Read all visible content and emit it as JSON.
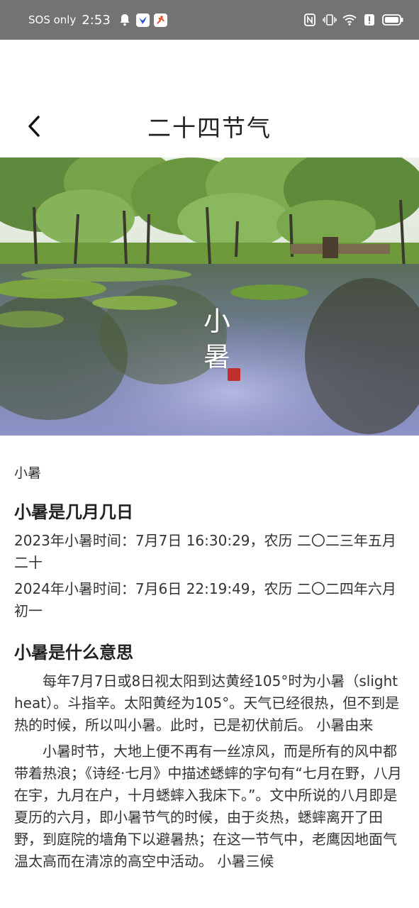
{
  "status_bar": {
    "carrier": "SOS only",
    "time": "2:53"
  },
  "header": {
    "title": "二十四节气"
  },
  "hero": {
    "title_line1": "小",
    "title_line2": "暑"
  },
  "breadcrumb": "小暑",
  "sections": [
    {
      "heading": "小暑是几月几日",
      "paragraphs": [
        "2023年小暑时间：7月7日 16:30:29，农历 二〇二三年五月二十",
        "2024年小暑时间：7月6日 22:19:49，农历 二〇二四年六月初一"
      ]
    },
    {
      "heading": "小暑是什么意思",
      "paragraphs": [
        "每年7月7日或8日视太阳到达黄经105°时为小暑（slight heat）。斗指辛。太阳黄经为105°。天气已经很热，但不到是热的时候，所以叫小暑。此时，已是初伏前后。 小暑由来",
        "小暑时节，大地上便不再有一丝凉风，而是所有的风中都带着热浪；《诗经·七月》中描述蟋蟀的字句有“七月在野，八月在宇，九月在户，十月蟋蟀入我床下。”。文中所说的八月即是夏历的六月，即小暑节气的时候，由于炎热，蟋蟀离开了田野，到庭院的墙角下以避暑热；在这一节气中，老鹰因地面气温太高而在清凉的高空中活动。 小暑三候"
      ]
    }
  ]
}
